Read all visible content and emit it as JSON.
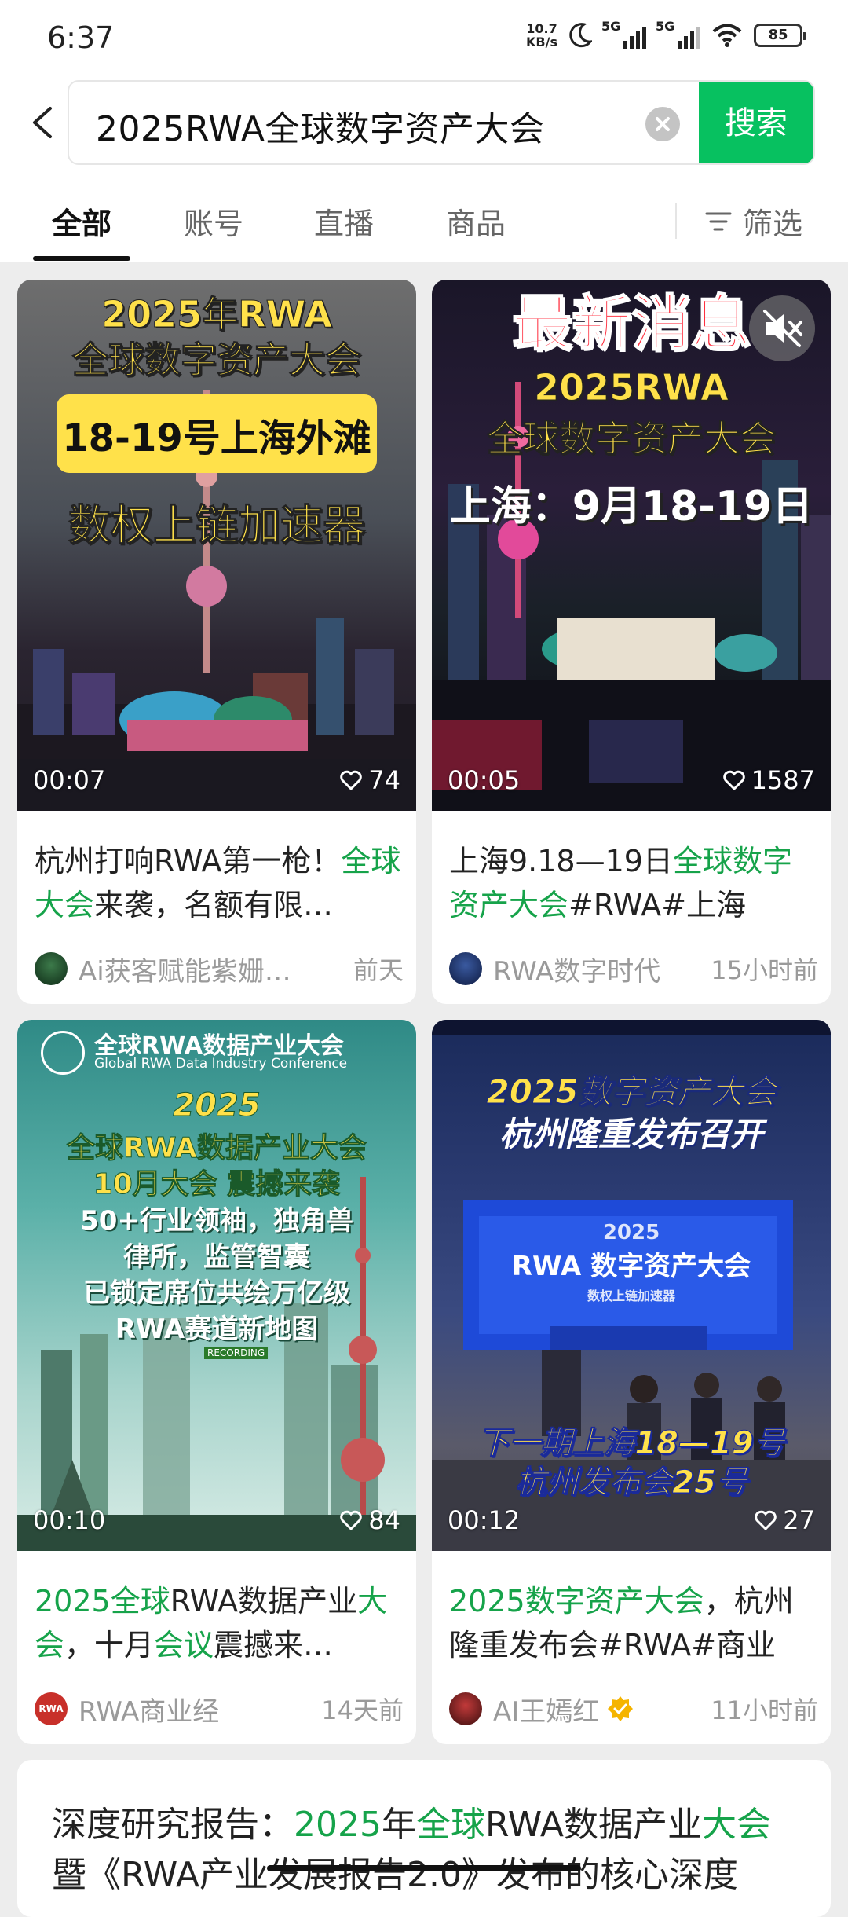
{
  "status": {
    "time": "6:37",
    "netspeed_top": "10.7",
    "netspeed_bottom": "KB/s",
    "sig1": "5G",
    "sig2": "5G",
    "battery": "85"
  },
  "search": {
    "query": "2025RWA全球数字资产大会",
    "button": "搜索"
  },
  "tabs": [
    {
      "label": "全部"
    },
    {
      "label": "账号"
    },
    {
      "label": "直播"
    },
    {
      "label": "商品"
    }
  ],
  "filter_label": "筛选",
  "cards": [
    {
      "overlay": [
        "2025年RWA",
        "全球数字资产大会",
        "18-19号上海外滩",
        "数权上链加速器"
      ],
      "duration": "00:07",
      "likes": "74",
      "title_parts": [
        "杭州打响RWA第一枪！",
        "全球大会",
        "来袭，名额有限…"
      ],
      "author": "Ai获客赋能紫姗…",
      "time": "前天"
    },
    {
      "overlay": [
        "最新消息",
        "2025RWA",
        "全球数字资产大会",
        "上海：9月18-19日"
      ],
      "duration": "00:05",
      "likes": "1587",
      "title_parts": [
        "上海9.18—19日",
        "全球数字资产大会",
        "#RWA#上海"
      ],
      "author": "RWA数字时代",
      "time": "15小时前"
    },
    {
      "overlay": [
        "全球RWA数据产业大会",
        "Global RWA Data Industry Conference",
        "2025",
        "全球RWA数据产业大会",
        "10月大会 震撼来袭",
        "50+行业领袖，独角兽",
        "律所，监管智囊",
        "已锁定席位共绘万亿级",
        "RWA赛道新地图",
        "RECORDING"
      ],
      "duration": "00:10",
      "likes": "84",
      "title_parts": [
        "2025全球",
        "RWA数据产业",
        "大会",
        "，十月",
        "会议",
        "震撼来…"
      ],
      "author": "RWA商业经",
      "time": "14天前",
      "avatar_text": "RWA"
    },
    {
      "overlay": [
        "2025数字资产大会",
        "杭州隆重发布召开",
        "2025",
        "RWA 数字资产大会",
        "数权上链加速器",
        "下一期上海18—19号",
        "杭州发布会25号"
      ],
      "duration": "00:12",
      "likes": "27",
      "title_parts": [
        "2025数字资产大会",
        "，杭州隆重发布会#RWA#商业"
      ],
      "author": "AI王嫣红",
      "time": "11小时前"
    }
  ],
  "report": {
    "line1_parts": [
      "深度研究报告：",
      "2025",
      "年",
      "全球",
      "RWA数据产业",
      "大会"
    ],
    "line2": "暨《RWA产业发展报告2.0》发布的核心深度"
  },
  "colors": {
    "accent": "#07c160",
    "highlight": "#16a34a"
  }
}
